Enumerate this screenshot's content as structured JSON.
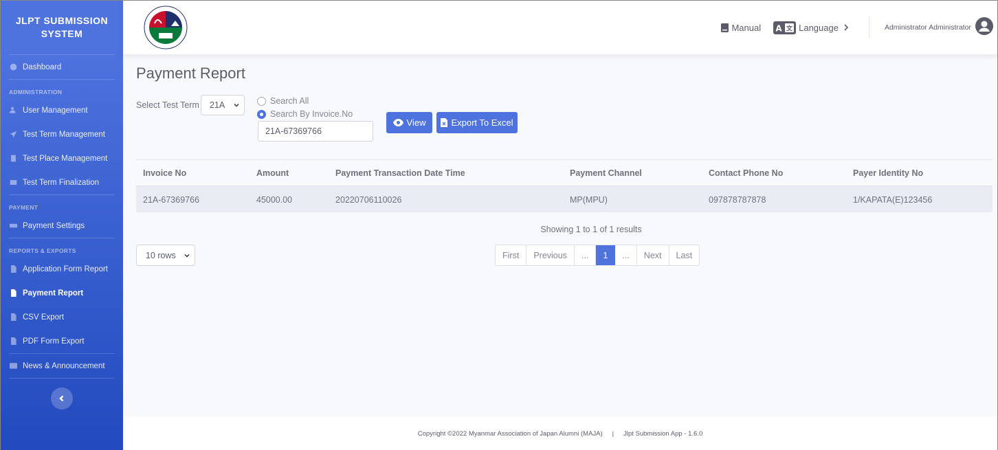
{
  "sidebar": {
    "brand": "JLPT SUBMISSION SYSTEM",
    "dashboard": "Dashboard",
    "admin_heading": "ADMINISTRATION",
    "admin_items": [
      "User Management",
      "Test Term Management",
      "Test Place Management",
      "Test Term Finalization"
    ],
    "payment_heading": "PAYMENT",
    "payment_items": [
      "Payment Settings"
    ],
    "reports_heading": "REPORTS & EXPORTS",
    "report_items": [
      "Application Form Report",
      "Payment Report",
      "CSV Export",
      "PDF Form Export"
    ],
    "news": "News & Announcement"
  },
  "topbar": {
    "manual": "Manual",
    "language": "Language",
    "user": "Administrator Administrator"
  },
  "page": {
    "title": "Payment Report",
    "test_term_label": "Select Test Term",
    "test_term_value": "21A",
    "radio_all": "Search All",
    "radio_invoice": "Search By Invoice.No",
    "invoice_value": "21A-67369766",
    "view_btn": "View",
    "export_btn": "Export To Excel"
  },
  "table": {
    "headers": [
      "Invoice No",
      "Amount",
      "Payment Transaction Date Time",
      "Payment Channel",
      "Contact Phone No",
      "Payer Identity No"
    ],
    "rows": [
      [
        "21A-67369766",
        "45000.00",
        "20220706110026",
        "MP(MPU)",
        "097878787878",
        "1/KAPATA(E)123456"
      ]
    ]
  },
  "pagination": {
    "showing": "Showing 1 to 1 of 1 results",
    "rows_per_page": "10 rows",
    "first": "First",
    "previous": "Previous",
    "ellipsis_left": "...",
    "current": "1",
    "ellipsis_right": "...",
    "next": "Next",
    "last": "Last"
  },
  "footer": {
    "copyright": "Copyright ©2022 Myanmar Association of Japan Alumni (MAJA)",
    "separator": "|",
    "version": "Jlpt Submission App - 1.6.0"
  },
  "colors": {
    "primary": "#4e73df",
    "sidebar_end": "#224abe",
    "logo_red": "#c8102e",
    "logo_green": "#0a7a3c",
    "logo_navy": "#1e2f6b"
  }
}
